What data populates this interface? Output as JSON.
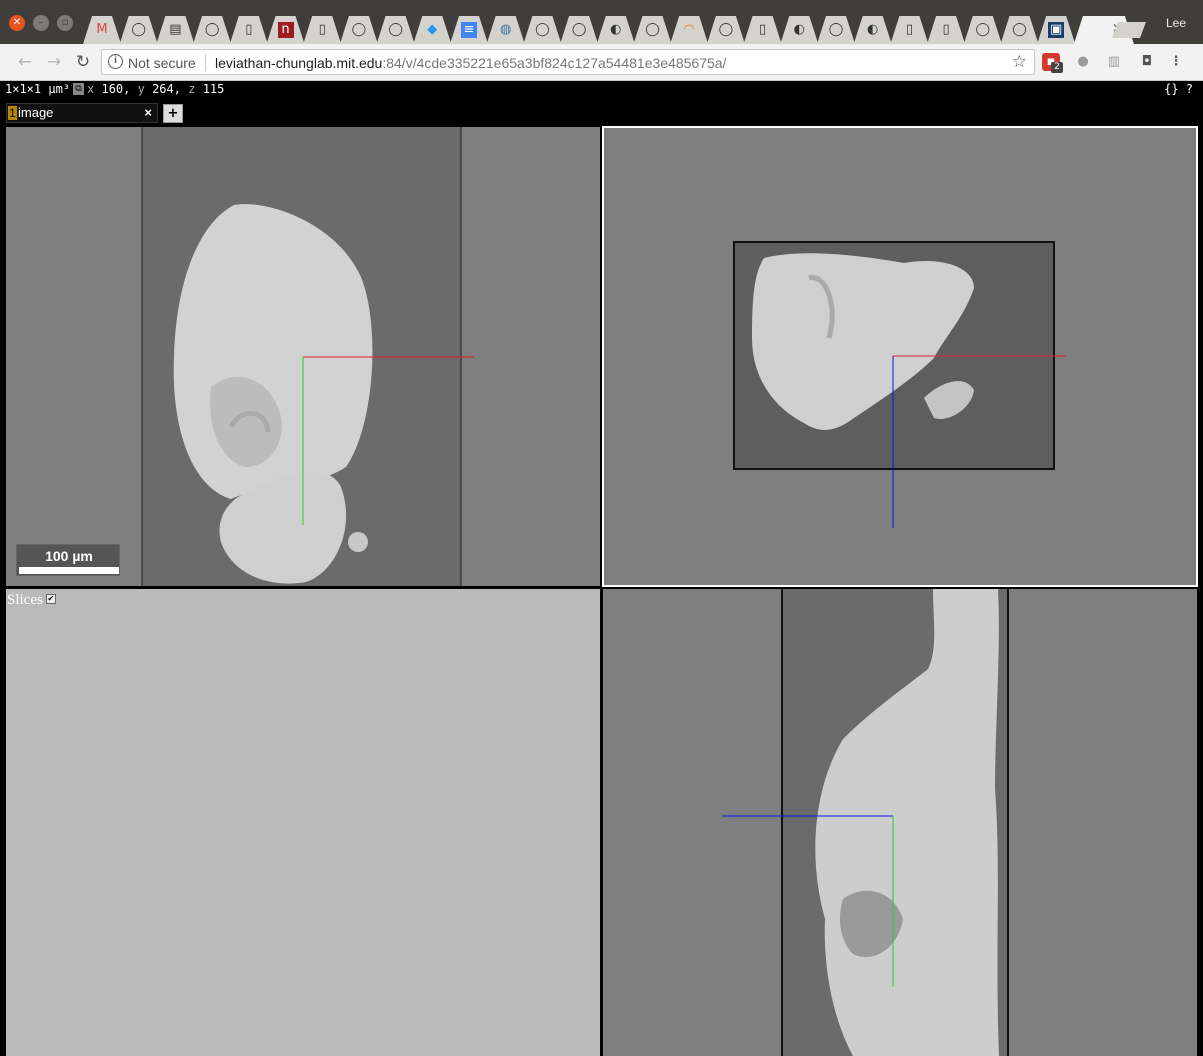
{
  "browser": {
    "tab_favicons": [
      "gmail-icon",
      "github-icon",
      "image-icon",
      "github-icon",
      "document-icon",
      "n-icon",
      "document-icon",
      "github-icon",
      "github-icon",
      "docker-icon",
      "docs-icon",
      "python-icon",
      "github-icon",
      "github-icon",
      "app-icon",
      "github-icon",
      "jupyter-icon",
      "github-icon",
      "document-icon",
      "app-icon",
      "github-icon",
      "app-icon",
      "document-icon",
      "document-icon",
      "github-icon",
      "github-icon",
      "allen-icon"
    ],
    "active_tab_close": "×",
    "profile_name": "Lee",
    "security_label": "Not secure",
    "url_host": "leviathan-chunglab.mit.edu",
    "url_path": ":84/v/4cde335221e65a3bf824c127a54481e3e485675a/",
    "extension_badge": "2"
  },
  "viewer": {
    "voxel_size": "1×1×1 µm³",
    "coord_x_label": "x",
    "coord_x": "160,",
    "coord_y_label": "y",
    "coord_y": "264,",
    "coord_z_label": "z",
    "coord_z": "115",
    "top_right_buttons": "{} ?",
    "layer": {
      "number": "1",
      "name": "image",
      "close": "×"
    },
    "add_layer": "+",
    "scalebar_label": "100 µm",
    "slices_label": "Slices",
    "slices_checked": true
  },
  "colors": {
    "red_axis": "#e02020",
    "green_axis": "#20d020",
    "blue_axis": "#1010e0",
    "panel_bg": "#7f7f7f",
    "slices_bg": "#bababa"
  }
}
